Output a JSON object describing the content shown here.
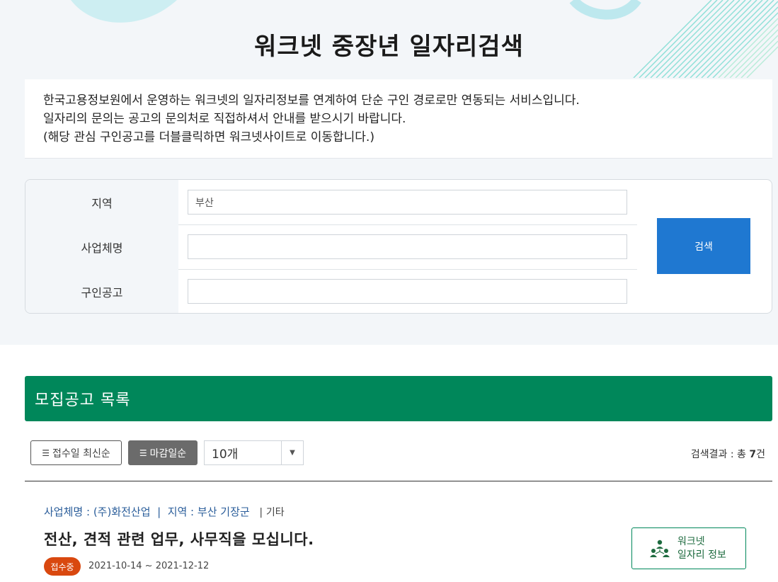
{
  "page_title": "워크넷 중장년 일자리검색",
  "notice_lines": [
    "한국고용정보원에서 운영하는 워크넷의 일자리정보를 연계하여 단순 구인 경로로만 연동되는 서비스입니다.",
    "일자리의 문의는 공고의 문의처로 직접하셔서 안내를 받으시기 바랍니다.",
    "(해당 관심 구인공고를 더블클릭하면 워크넷사이트로 이동합니다.)"
  ],
  "search": {
    "region_label": "지역",
    "region_value": "부산",
    "company_label": "사업체명",
    "company_value": "",
    "job_label": "구인공고",
    "job_value": "",
    "button_label": "검색"
  },
  "list": {
    "header": "모집공고 목록",
    "sort_latest": "접수일 최신순",
    "sort_deadline": "마감일순",
    "per_page": "10개",
    "result_prefix": "검색결과 : 총",
    "result_count": "7",
    "result_suffix": "건"
  },
  "jobs": [
    {
      "company_label": "사업체명 :",
      "company": "(주)화전산업",
      "region_label": "지역 :",
      "region": "부산 기장군",
      "etc": "기타",
      "title": "전산, 견적 관련 업무, 사무직을 모십니다.",
      "status": "접수중",
      "dates": "2021-10-14 ~ 2021-12-12",
      "worknet_line1": "워크넷",
      "worknet_line2": "일자리 정보"
    }
  ],
  "icons": {
    "sort": "list-icon",
    "select_arrow": "caret-down-icon",
    "worknet": "people-icon"
  },
  "colors": {
    "accent_green": "#00875a",
    "search_button": "#1f78d1",
    "status_badge": "#d9480f",
    "meta_blue": "#2a5d9a"
  }
}
